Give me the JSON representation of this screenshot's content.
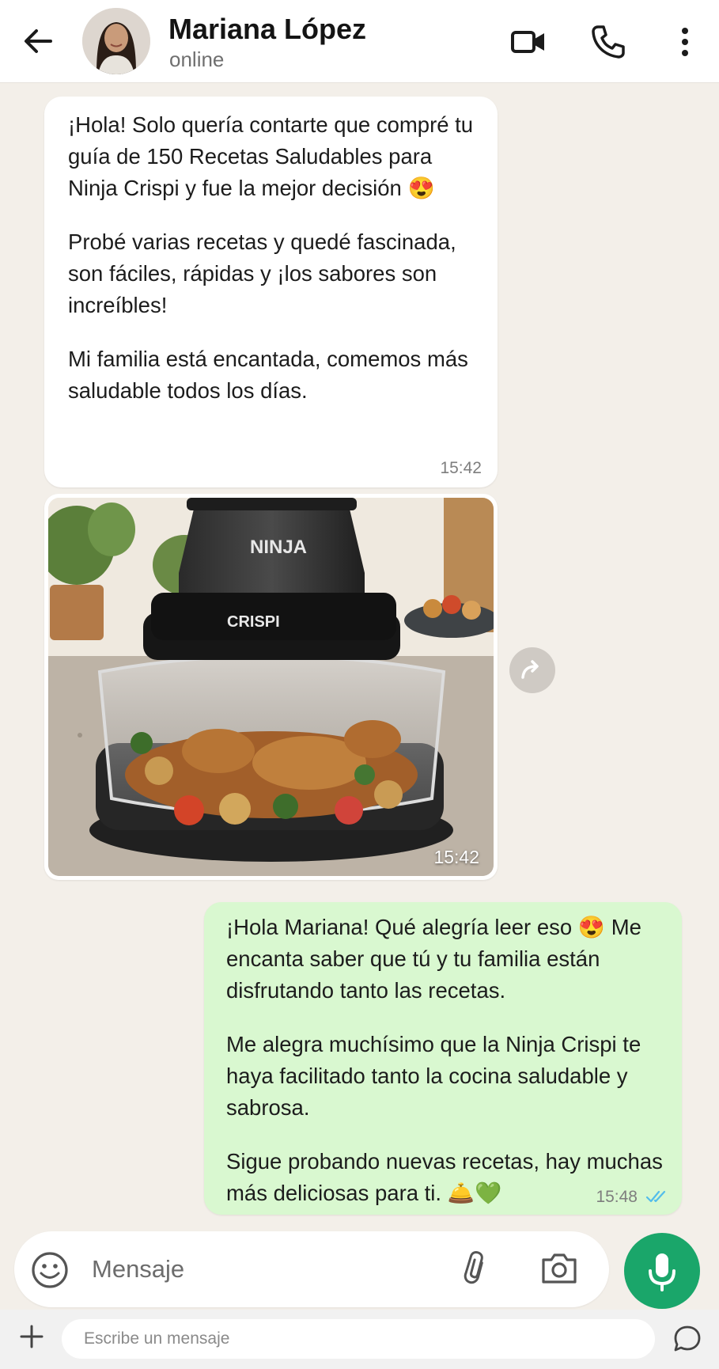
{
  "header": {
    "contact_name": "Mariana López",
    "status": "online",
    "icons": [
      "back-arrow-icon",
      "video-call-icon",
      "voice-call-icon",
      "more-options-icon"
    ]
  },
  "messages": {
    "incoming_text": {
      "paragraphs": [
        "¡Hola! Solo quería contarte que compré tu guía de 150 Recetas Saludables para Ninja Crispi y fue la mejor decisión 😍",
        "Probé varias recetas y quedé fascinada, son fáciles, rápidas y ¡los sabores son increíbles!",
        "Mi familia está encantada, comemos más saludable todos los días."
      ],
      "time": "15:42"
    },
    "incoming_image": {
      "brand_top": "NINJA",
      "brand_bottom": "CRISPI",
      "time": "15:42"
    },
    "outgoing_text": {
      "paragraphs": [
        "¡Hola Mariana! Qué alegría leer eso 😍 Me encanta saber que tú y tu familia están disfrutando tanto las recetas.",
        "Me alegra muchísimo que la Ninja Crispi te haya facilitado tanto la cocina saludable y sabrosa.",
        "Sigue probando nuevas recetas, hay muchas más deliciosas para ti. 🛎️💚"
      ],
      "time": "15:48",
      "read_receipt": "double-check-icon"
    }
  },
  "composer": {
    "placeholder": "Mensaje",
    "icons": [
      "emoji-icon",
      "attach-icon",
      "camera-icon",
      "mic-icon"
    ]
  },
  "bottom_bar": {
    "placeholder": "Escribe un mensaje",
    "icons": [
      "plus-icon",
      "chat-bubble-icon"
    ]
  },
  "colors": {
    "outgoing_bubble": "#d9f8d0",
    "incoming_bubble": "#ffffff",
    "chat_background": "#f3efe9",
    "mic_button": "#1aa66a",
    "read_tick": "#53bdeb"
  }
}
